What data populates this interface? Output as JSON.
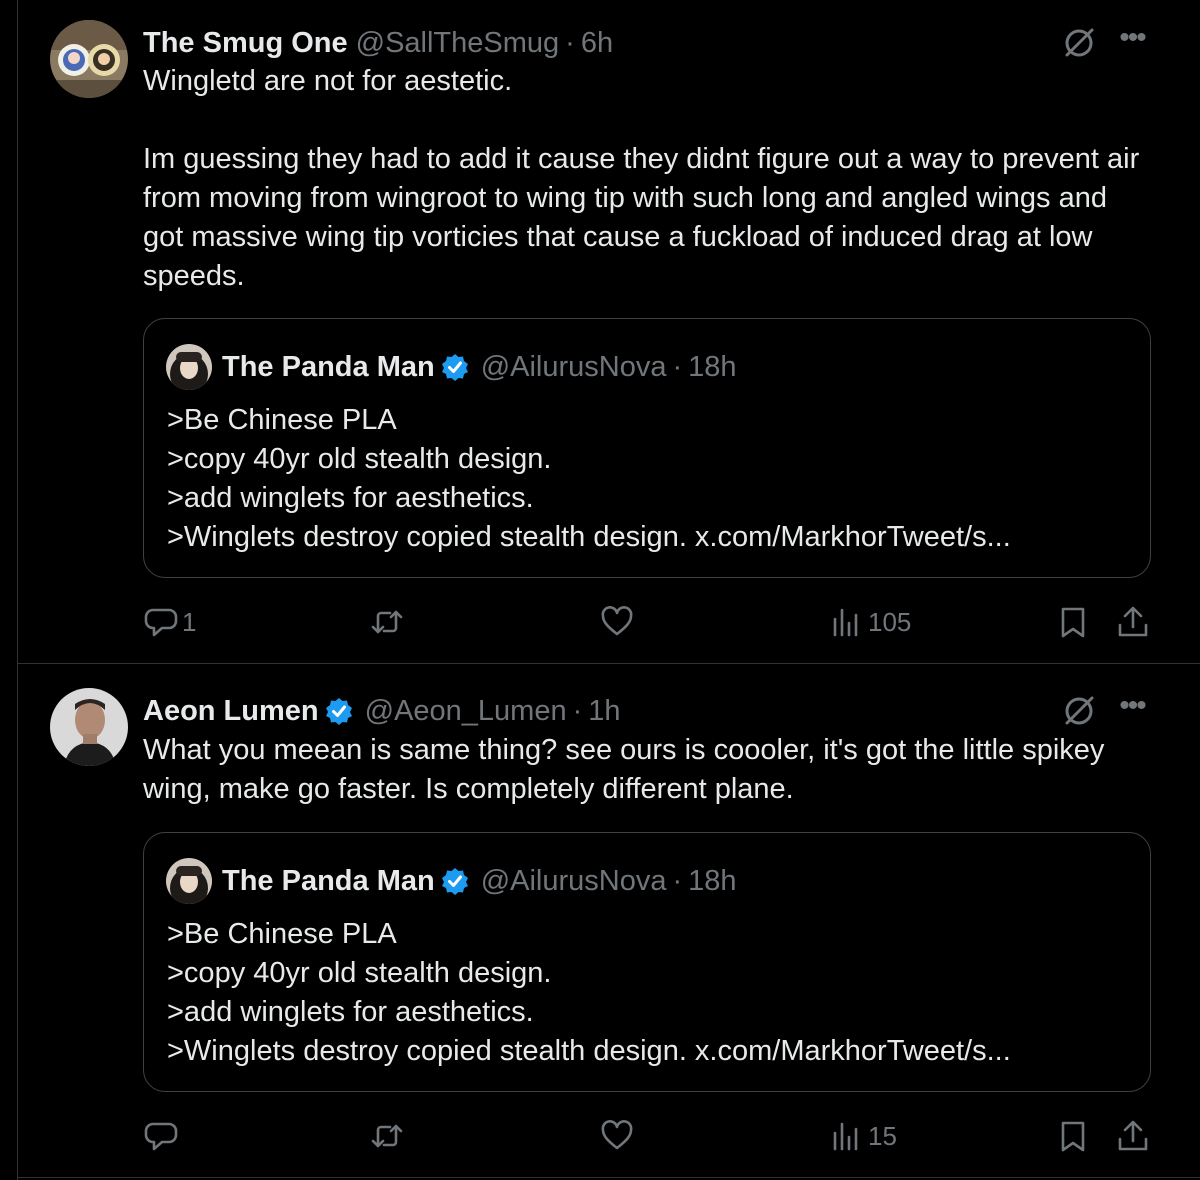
{
  "tweets": [
    {
      "author": {
        "name": "The Smug One",
        "handle": "@SallTheSmug",
        "time": "6h",
        "verified": false
      },
      "text": "Wingletd are not for aestetic.\n\nIm guessing they had to add it cause they didnt figure out a way to prevent air from moving from wingroot to wing tip with such long and angled wings and got massive wing tip vorticies that cause a fuckload of induced drag at low speeds.",
      "quote": {
        "author": {
          "name": "The Panda Man",
          "handle": "@AilurusNova",
          "time": "18h",
          "verified": true
        },
        "lines": [
          ">Be Chinese PLA",
          ">copy 40yr old stealth design.",
          ">add winglets for aesthetics.",
          ">Winglets destroy copied stealth design. x.com/MarkhorTweet/s..."
        ]
      },
      "actions": {
        "replies": "1",
        "reposts": "",
        "likes": "",
        "views": "105"
      }
    },
    {
      "author": {
        "name": "Aeon Lumen",
        "handle": "@Aeon_Lumen",
        "time": "1h",
        "verified": true
      },
      "text": "What you meean is same thing? see ours is coooler, it's got the little spikey wing, make go faster. Is completely different plane.",
      "quote": {
        "author": {
          "name": "The Panda Man",
          "handle": "@AilurusNova",
          "time": "18h",
          "verified": true
        },
        "lines": [
          ">Be Chinese PLA",
          ">copy 40yr old stealth design.",
          ">add winglets for aesthetics.",
          ">Winglets destroy copied stealth design. x.com/MarkhorTweet/s..."
        ]
      },
      "actions": {
        "replies": "",
        "reposts": "",
        "likes": "",
        "views": "15"
      }
    }
  ],
  "separator": "·",
  "icons": {
    "grok": "grok-icon",
    "more": "more-icon",
    "reply": "reply-icon",
    "repost": "repost-icon",
    "like": "heart-icon",
    "views": "views-icon",
    "bookmark": "bookmark-icon",
    "share": "share-icon",
    "verified": "verified-badge-icon"
  },
  "colors": {
    "background": "#000000",
    "text": "#e7e9ea",
    "muted": "#71767b",
    "border": "#2f3336",
    "verified": "#1d9bf0"
  }
}
